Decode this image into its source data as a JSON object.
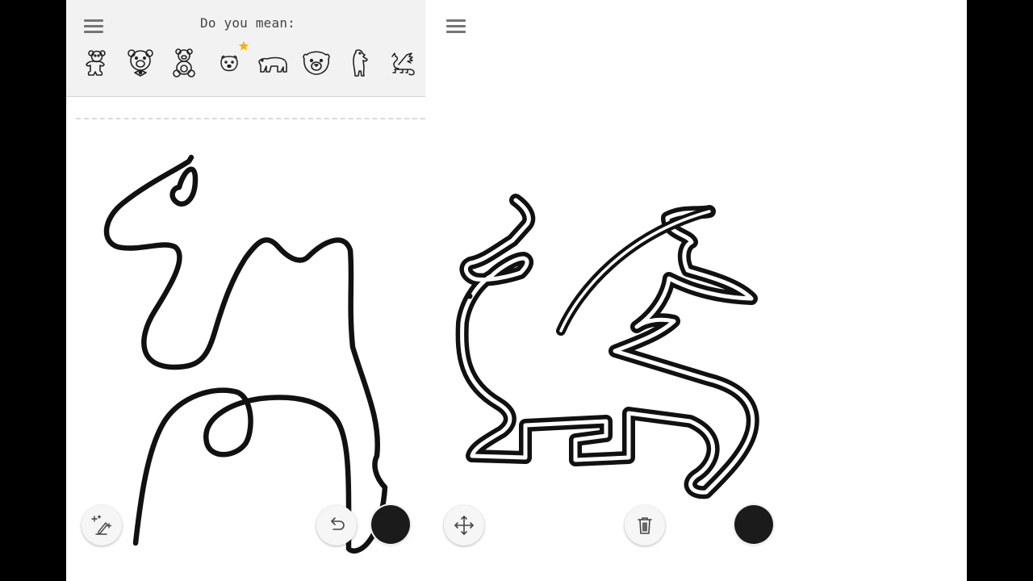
{
  "left_screen": {
    "prompt": "Do you mean:",
    "suggestions": [
      {
        "name": "teddy-bear-outline",
        "icon": "teddy-bear-outline-icon"
      },
      {
        "name": "bear-face-bow",
        "icon": "bear-face-bow-icon"
      },
      {
        "name": "sitting-teddy-bear",
        "icon": "sitting-teddy-bear-icon"
      },
      {
        "name": "polar-bear-face",
        "icon": "polar-bear-face-icon",
        "starred": true
      },
      {
        "name": "polar-bear-walking",
        "icon": "polar-bear-walking-icon"
      },
      {
        "name": "bear-head",
        "icon": "bear-head-icon"
      },
      {
        "name": "standing-bear",
        "icon": "standing-bear-icon"
      },
      {
        "name": "dragon",
        "icon": "dragon-icon"
      }
    ],
    "toolbar": {
      "magic_icon": "magic-pen-icon",
      "undo_icon": "undo-icon",
      "color": "#1b1b1b"
    }
  },
  "right_screen": {
    "toolbar": {
      "move_icon": "move-arrows-icon",
      "delete_icon": "trash-icon",
      "color": "#1b1b1b"
    }
  },
  "colors": {
    "ink": "#111111",
    "star": "#f4b400",
    "bar_bg": "#f2f2f2"
  }
}
